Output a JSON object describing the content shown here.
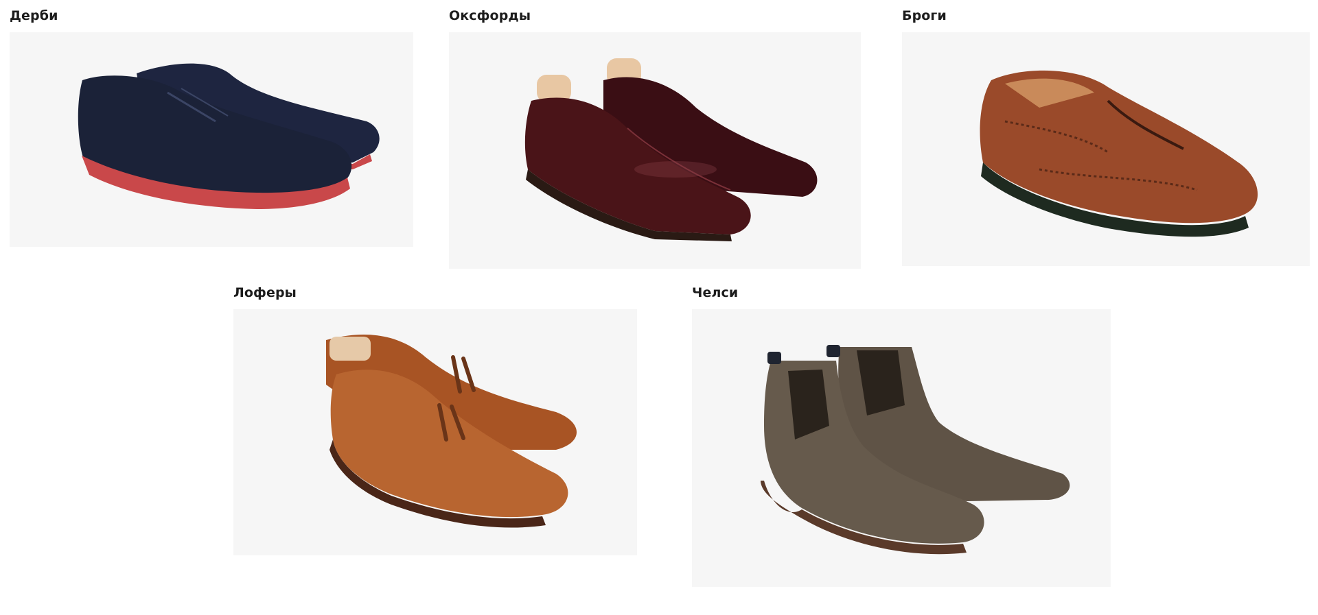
{
  "gallery": {
    "items": [
      {
        "title": "Дерби",
        "image_icon": "derby-shoe-icon"
      },
      {
        "title": "Оксфорды",
        "image_icon": "oxford-shoe-icon"
      },
      {
        "title": "Броги",
        "image_icon": "brogue-shoe-icon"
      },
      {
        "title": "Лоферы",
        "image_icon": "loafer-shoe-icon"
      },
      {
        "title": "Челси",
        "image_icon": "chelsea-boot-icon"
      }
    ]
  },
  "colors": {
    "image_background": "#f6f6f6",
    "title_text": "#1c1c1c",
    "derby_upper": "#1b2238",
    "derby_sole": "#c9484a",
    "oxford_upper": "#4a1418",
    "brogue_upper": "#9a4a2a",
    "loafer_upper": "#b86530",
    "chelsea_upper": "#5f5346"
  }
}
